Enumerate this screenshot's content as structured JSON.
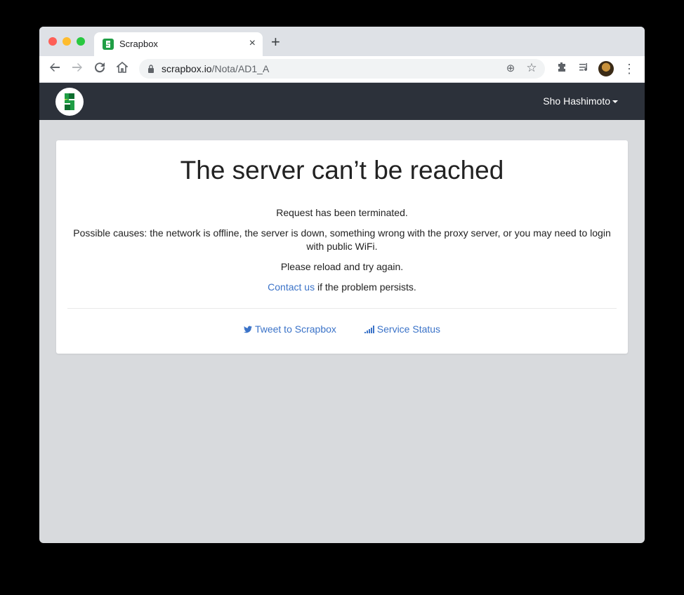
{
  "browser": {
    "tab_title": "Scrapbox",
    "tab_close": "×",
    "new_tab": "+",
    "url_domain": "scrapbox.io",
    "url_path": "/Nota/AD1_A"
  },
  "header": {
    "user_name": "Sho Hashimoto"
  },
  "error": {
    "title": "The server can’t be reached",
    "line1": "Request has been terminated.",
    "line2": "Possible causes: the network is offline, the server is down, something wrong with the proxy server, or you may need to login with public WiFi.",
    "line3": "Please reload and try again.",
    "contact_link": "Contact us",
    "contact_suffix": " if the problem persists.",
    "tweet_link": "Tweet to Scrapbox",
    "status_link": "Service Status"
  },
  "colors": {
    "header_bg": "#2c313a",
    "link": "#3b73c8",
    "page_bg": "#d8dadd"
  }
}
